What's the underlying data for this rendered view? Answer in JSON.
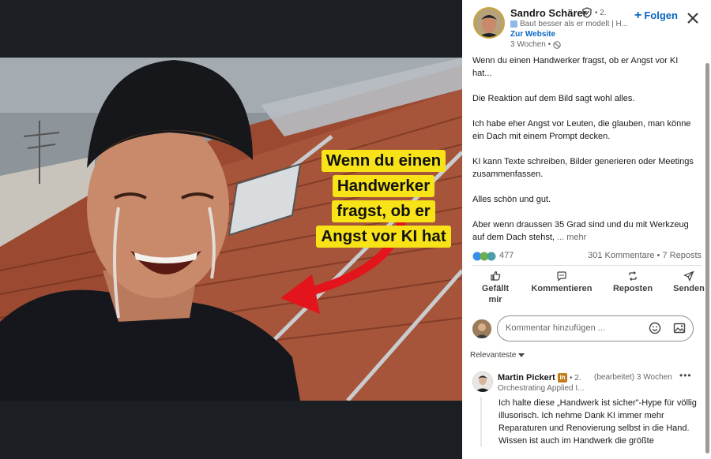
{
  "media": {
    "caption_lines": [
      "Wenn du einen",
      "Handwerker",
      "fragst, ob er",
      "Angst vor KI hat"
    ]
  },
  "post": {
    "author": {
      "name": "Sandro Schärer",
      "degree": "• 2.",
      "headline": "Baut besser als er modelt | H...",
      "website_label": "Zur Website",
      "time": "3 Wochen •"
    },
    "follow_label": "Folgen",
    "paragraphs": [
      "Wenn du einen Handwerker fragst, ob er Angst vor KI hat...",
      "Die Reaktion auf dem Bild sagt wohl alles.",
      "Ich habe eher Angst vor Leuten, die glauben, man könne ein Dach mit einem Prompt decken.",
      "KI kann Texte schreiben, Bilder generieren oder Meetings zusammenfassen.",
      "Alles schön und gut."
    ],
    "last_paragraph": "Aber wenn draussen 35 Grad sind und du mit Werkzeug auf dem Dach stehst,",
    "more_label": "... mehr"
  },
  "social": {
    "reactions_count": "477",
    "comments_reposts": "301 Kommentare • 7 Reposts"
  },
  "actions": [
    {
      "label": "Gefällt mir"
    },
    {
      "label": "Kommentieren"
    },
    {
      "label": "Reposten"
    },
    {
      "label": "Senden"
    }
  ],
  "comment_input": {
    "placeholder": "Kommentar hinzufügen ..."
  },
  "sort_label": "Relevanteste",
  "comments": [
    {
      "name": "Martin Pickert",
      "degree": "• 2.",
      "time": "(bearbeitet) 3 Wochen",
      "headline": "Orchestrating Applied I...",
      "text": "Ich halte diese „Handwerk ist sicher\"-Hype für völlig illusorisch. Ich nehme Dank KI immer mehr Reparaturen und Renovierung selbst in die Hand. Wissen ist auch im Handwerk die größte"
    }
  ],
  "colors": {
    "accent": "#0a66c2",
    "caption_yellow": "#f7e317",
    "arrow_red": "#e3141b"
  },
  "icons": [
    "verified-icon",
    "company-icon",
    "globe-icon",
    "close-icon",
    "plus-icon",
    "like-icon",
    "comment-icon",
    "repost-icon",
    "send-icon",
    "emoji-icon",
    "image-icon",
    "chevron-down-icon",
    "more-icon",
    "linkedin-icon"
  ]
}
